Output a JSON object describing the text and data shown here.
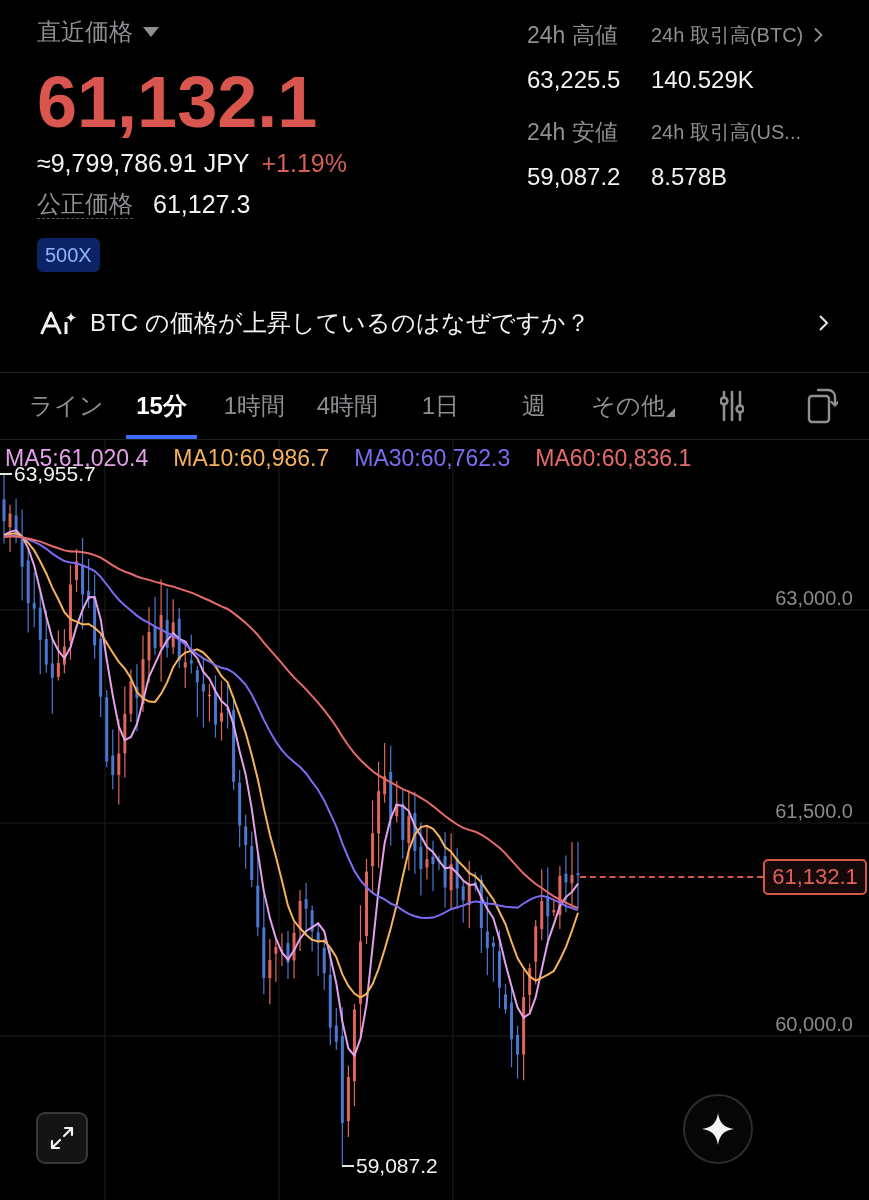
{
  "price_panel": {
    "title": "直近価格",
    "last_price": "61,132.1",
    "converted": "≈9,799,786.91 JPY",
    "change": "+1.19%",
    "fair_price_label": "公正価格",
    "fair_price": "61,127.3",
    "leverage_badge": "500X"
  },
  "stats": [
    {
      "label": "24h 高値",
      "value": "63,225.5",
      "chevron": false
    },
    {
      "label": "24h 取引高(BTC)",
      "value": "140.529K",
      "chevron": true
    },
    {
      "label": "24h 安値",
      "value": "59,087.2",
      "chevron": false
    },
    {
      "label": "24h 取引高(US...",
      "value": "8.578B",
      "chevron": false
    }
  ],
  "ai_prompt": {
    "text": "BTC の価格が上昇しているのはなぜですか？"
  },
  "timeframes": [
    {
      "label": "ライン",
      "selected": false,
      "kind": "tab"
    },
    {
      "label": "15分",
      "selected": true,
      "kind": "tab"
    },
    {
      "label": "1時間",
      "selected": false,
      "kind": "tab"
    },
    {
      "label": "4時間",
      "selected": false,
      "kind": "tab"
    },
    {
      "label": "1日",
      "selected": false,
      "kind": "tab"
    },
    {
      "label": "週",
      "selected": false,
      "kind": "tab"
    },
    {
      "label": "その他",
      "selected": false,
      "kind": "dropdown"
    }
  ],
  "chart": {
    "moving_averages": [
      {
        "label": "MA5:61,020.4",
        "color": "#e3a1ea"
      },
      {
        "label": "MA10:60,986.7",
        "color": "#f5b25c"
      },
      {
        "label": "MA30:60,762.3",
        "color": "#7b6cf2"
      },
      {
        "label": "MA60:60,836.1",
        "color": "#e76b6b"
      }
    ],
    "high_label": "63,955.7",
    "low_label": "59,087.2",
    "y_axis": [
      "63,000.0",
      "61,500.0",
      "60,000.0"
    ],
    "current_price": "61,132.1"
  }
}
